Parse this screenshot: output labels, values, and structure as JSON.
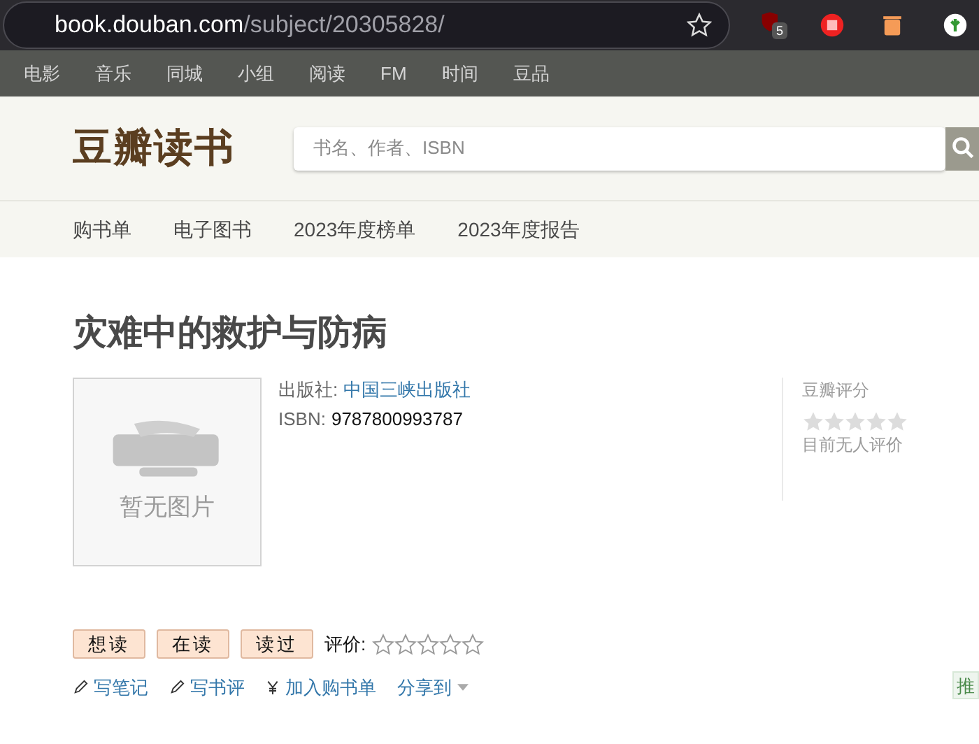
{
  "browser": {
    "url_host": "book.douban.com",
    "url_path": "/subject/20305828/",
    "extension_badge": "5"
  },
  "global_nav": [
    "电影",
    "音乐",
    "同城",
    "小组",
    "阅读",
    "FM",
    "时间",
    "豆品"
  ],
  "header": {
    "logo": "豆瓣读书",
    "search": {
      "placeholder": "书名、作者、ISBN"
    }
  },
  "sub_nav": [
    "购书单",
    "电子图书",
    "2023年度榜单",
    "2023年度报告"
  ],
  "book": {
    "title": "灾难中的救护与防病",
    "cover_text": "暂无图片",
    "info": [
      {
        "label": "出版社:",
        "value": "中国三峡出版社",
        "kind": "link"
      },
      {
        "label": "ISBN:",
        "value": "9787800993787",
        "kind": "plain"
      }
    ]
  },
  "rating": {
    "title": "豆瓣评分",
    "stars": 0,
    "note": "目前无人评价"
  },
  "status_buttons": [
    "想读",
    "在读",
    "读过"
  ],
  "my_rating": {
    "label": "评价:",
    "stars": 0
  },
  "actions": [
    {
      "label": "写笔记",
      "kind": "pencil"
    },
    {
      "label": "写书评",
      "kind": "pencil"
    },
    {
      "label": "加入购书单",
      "kind": "yen"
    },
    {
      "label": "分享到",
      "kind": "dropdown"
    }
  ],
  "side_tag": "推"
}
